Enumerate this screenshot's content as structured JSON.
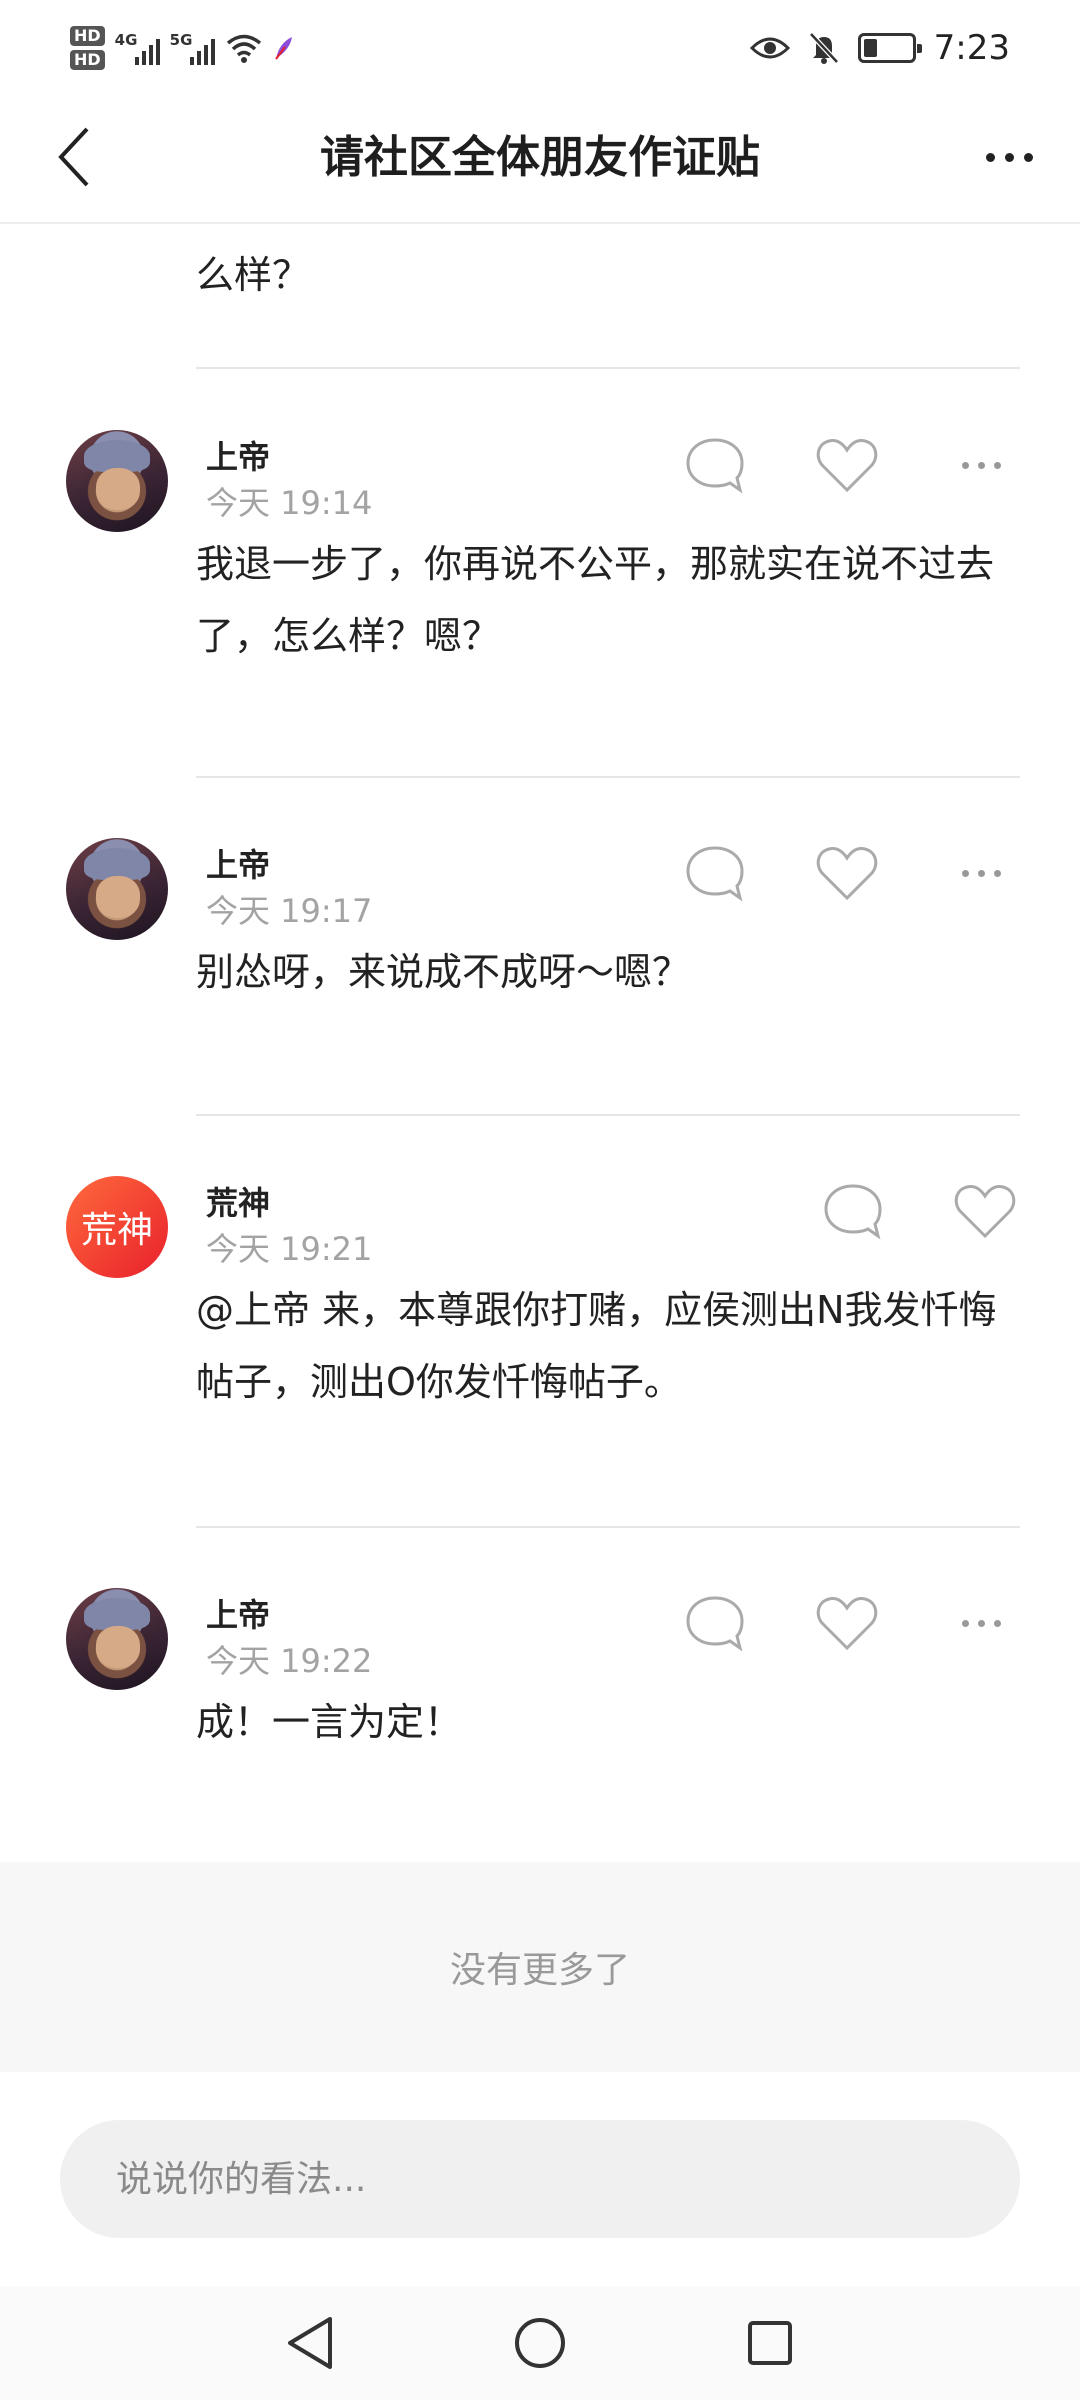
{
  "status_bar": {
    "hd1": "HD",
    "hd2": "HD",
    "net1": "4G",
    "net2": "5G",
    "time": "7:23",
    "battery_level": 0.3
  },
  "header": {
    "title": "请社区全体朋友作证贴",
    "back_icon": "chevron-left-icon",
    "more_icon": "more-horizontal-icon"
  },
  "partial_text": "么样？",
  "comments": [
    {
      "username": "上帝",
      "time": "今天 19:14",
      "text": "我退一步了，你再说不公平，那就实在说不过去了，怎么样？嗯？",
      "avatar": "photo"
    },
    {
      "username": "上帝",
      "time": "今天 19:17",
      "text": "别怂呀，来说成不成呀～嗯？",
      "avatar": "photo"
    },
    {
      "username": "荒神",
      "time": "今天 19:21",
      "text": "@上帝 来，本尊跟你打赌，应侯测出N我发忏悔帖子，测出O你发忏悔帖子。",
      "avatar_text": "荒神",
      "avatar": "text"
    },
    {
      "username": "上帝",
      "time": "今天 19:22",
      "text": "成！一言为定！",
      "avatar": "photo"
    }
  ],
  "footer": {
    "no_more": "没有更多了"
  },
  "input": {
    "placeholder": "说说你的看法..."
  },
  "colors": {
    "accent_avatar": "#e8202b",
    "muted_text": "#a3a3a3"
  }
}
